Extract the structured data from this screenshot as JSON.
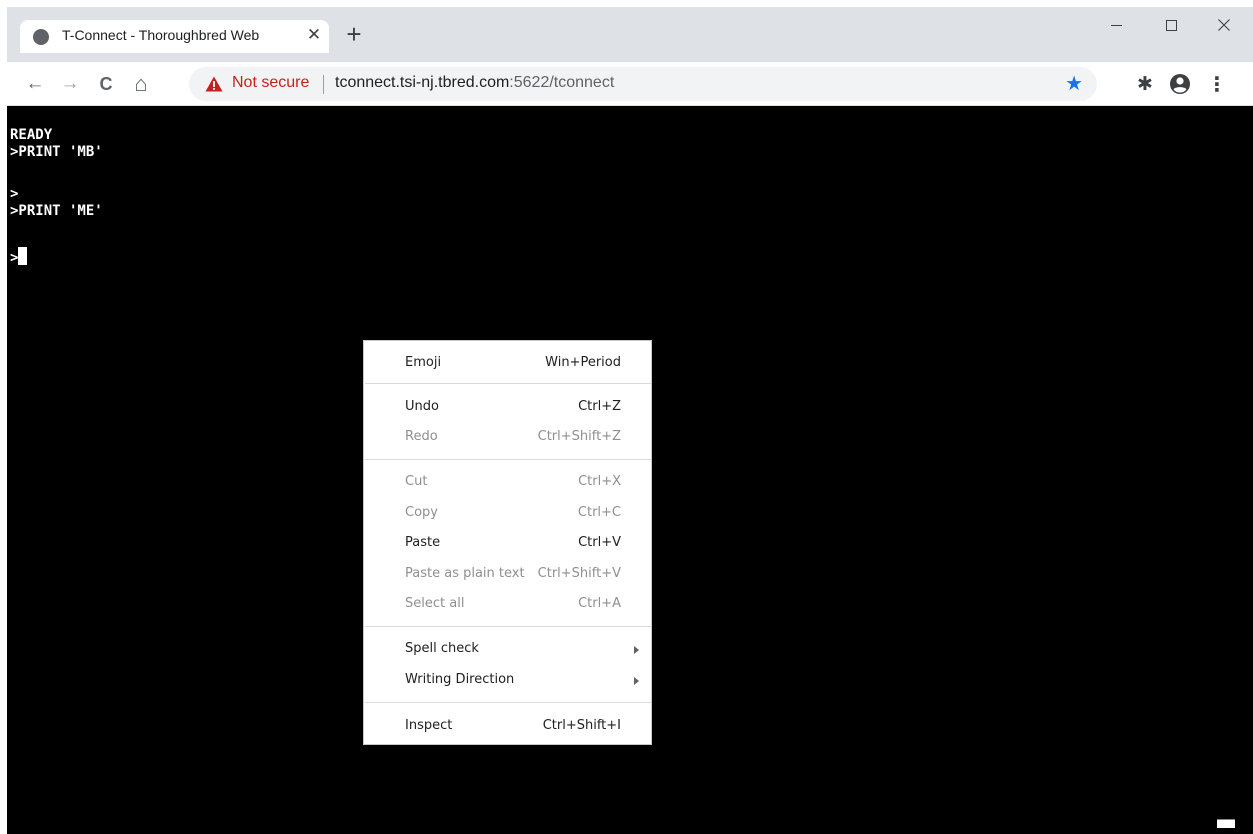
{
  "browser": {
    "tab": {
      "title": "T-Connect - Thoroughbred Web",
      "close_glyph": "✕",
      "favicon": "globe-icon"
    },
    "new_tab_glyph": "+",
    "window_controls": [
      "minimize-icon",
      "maximize-icon",
      "close-icon"
    ],
    "toolbar": {
      "back_glyph": "←",
      "forward_glyph": "→",
      "reload_glyph": "C",
      "home_glyph": "⌂",
      "security_label": "Not secure",
      "url_host": "tconnect.tsi-nj.tbred.com",
      "url_path": ":5622/tconnect",
      "star_glyph": "★",
      "extensions_glyph": "✱",
      "profile_icon": "account-circle-icon",
      "menu_glyph": "⋮"
    },
    "colors": {
      "not_secure": "#c5221f",
      "star": "#1a73e8",
      "terminal_bg": "#000000",
      "terminal_fg": "#ffffff"
    }
  },
  "terminal": {
    "lines": [
      "READY",
      ">PRINT 'MB'",
      ">",
      ">PRINT 'ME'",
      ">"
    ]
  },
  "context_menu": {
    "items": [
      {
        "label": "Emoji",
        "shortcut": "Win+Period",
        "enabled": true
      },
      {
        "label": "Undo",
        "shortcut": "Ctrl+Z",
        "enabled": true
      },
      {
        "label": "Redo",
        "shortcut": "Ctrl+Shift+Z",
        "enabled": false
      },
      {
        "label": "Cut",
        "shortcut": "Ctrl+X",
        "enabled": false
      },
      {
        "label": "Copy",
        "shortcut": "Ctrl+C",
        "enabled": false
      },
      {
        "label": "Paste",
        "shortcut": "Ctrl+V",
        "enabled": true
      },
      {
        "label": "Paste as plain text",
        "shortcut": "Ctrl+Shift+V",
        "enabled": false
      },
      {
        "label": "Select all",
        "shortcut": "Ctrl+A",
        "enabled": false
      },
      {
        "label": "Spell check",
        "shortcut": "",
        "enabled": true,
        "submenu": true
      },
      {
        "label": "Writing Direction",
        "shortcut": "",
        "enabled": true,
        "submenu": true
      },
      {
        "label": "Inspect",
        "shortcut": "Ctrl+Shift+I",
        "enabled": true
      }
    ]
  }
}
